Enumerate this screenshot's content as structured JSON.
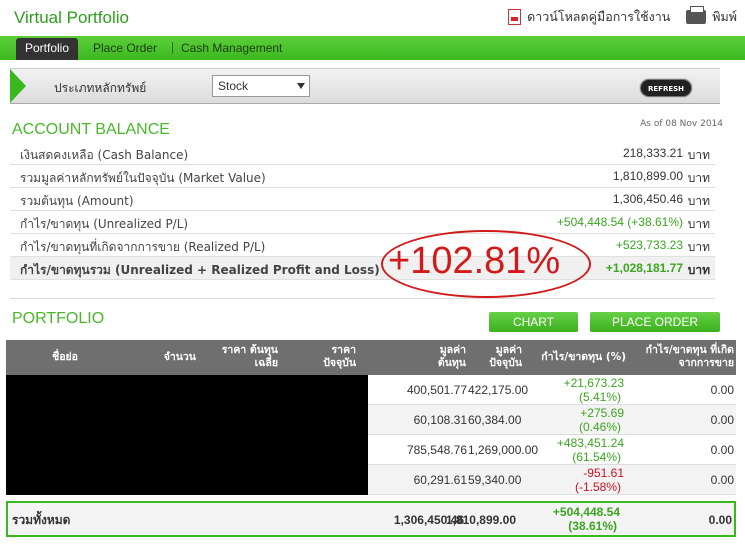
{
  "header": {
    "title": "Virtual Portfolio",
    "download_manual": "ดาวน์โหลดคู่มือการใช้งาน",
    "print": "พิมพ์"
  },
  "tabs": [
    "Portfolio",
    "Place Order",
    "Cash Management"
  ],
  "filter": {
    "label": "ประเภทหลักทรัพย์",
    "selected": "Stock",
    "refresh": "REFRESH"
  },
  "balance": {
    "title": "ACCOUNT BALANCE",
    "as_of": "As of 08 Nov 2014",
    "unit": "บาท",
    "rows": [
      {
        "label": "เงินสดคงเหลือ (Cash Balance)",
        "value": "218,333.21"
      },
      {
        "label": "รวมมูลค่าหลักทรัพย์ในปัจจุบัน (Market Value)",
        "value": "1,810,899.00"
      },
      {
        "label": "รวมต้นทุน (Amount)",
        "value": "1,306,450.46"
      },
      {
        "label": "กำไร/ขาดทุน (Unrealized P/L)",
        "value": "+504,448.54 (+38.61%)"
      },
      {
        "label": "กำไร/ขาดทุนที่เกิดจากการขาย (Realized P/L)",
        "value": "+523,733.23"
      },
      {
        "label": "กำไร/ขาดทุนรวม (Unrealized + Realized Profit and Loss)",
        "value": "+1,028,181.77"
      }
    ],
    "annotation": "+102.81%"
  },
  "portfolio": {
    "title": "PORTFOLIO",
    "chart_button": "CHART",
    "order_button": "PLACE ORDER",
    "columns": [
      "ชื่อย่อ",
      "จำนวน",
      "ราคา ต้นทุนเฉลี่ย",
      "ราคา ปัจจุบัน",
      "มูลค่า ต้นทุน",
      "มูลค่า ปัจจุบัน",
      "กำไร/ขาดทุน (%)",
      "กำไร/ขาดทุน ที่เกิดจากการขาย"
    ],
    "rows": [
      {
        "cost": "400,501.77",
        "market": "422,175.00",
        "pl": "+21,673.23",
        "pct": "(5.41%)",
        "realized": "0.00",
        "color": "#3aa520"
      },
      {
        "cost": "60,108.31",
        "market": "60,384.00",
        "pl": "+275.69",
        "pct": "(0.46%)",
        "realized": "0.00",
        "color": "#3aa520"
      },
      {
        "cost": "785,548.76",
        "market": "1,269,000.00",
        "pl": "+483,451.24",
        "pct": "(61.54%)",
        "realized": "0.00",
        "color": "#3aa520"
      },
      {
        "cost": "60,291.61",
        "market": "59,340.00",
        "pl": "-951.61",
        "pct": "(-1.58%)",
        "realized": "0.00",
        "color": "#c12222"
      }
    ],
    "total": {
      "label": "รวมทั้งหมด",
      "cost": "1,306,450.46",
      "market": "1,810,899.00",
      "pl": "+504,448.54",
      "pct": "(38.61%)",
      "realized": "0.00"
    }
  }
}
